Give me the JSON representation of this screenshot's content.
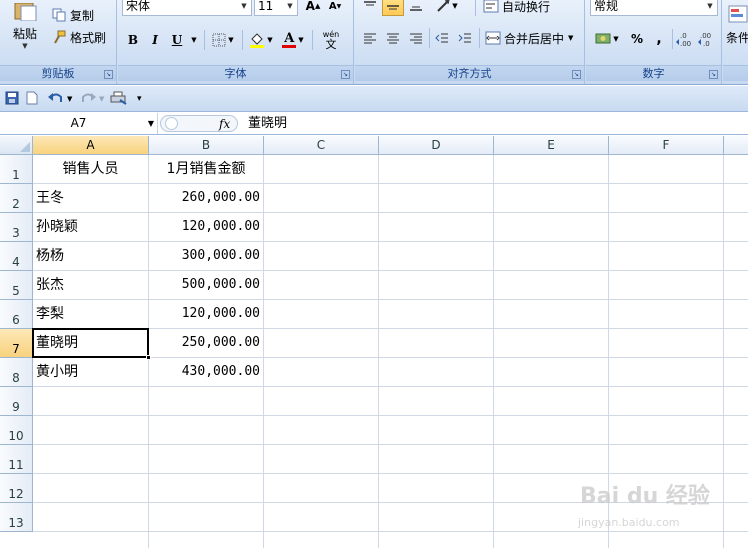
{
  "ribbon": {
    "clipboard": {
      "paste_label": "粘贴",
      "copy_label": "复制",
      "format_painter_label": "格式刷",
      "group_label": "剪贴板"
    },
    "font": {
      "font_name": "宋体",
      "font_size": "11",
      "group_label": "字体",
      "bold": "B",
      "italic": "I",
      "underline": "U",
      "grow": "A",
      "shrink": "A",
      "font_color_letter": "A",
      "phonetic": "wén"
    },
    "alignment": {
      "wrap_text_label": "自动换行",
      "merge_center_label": "合并后居中",
      "group_label": "对齐方式"
    },
    "number": {
      "format": "常规",
      "percent": "%",
      "comma": ",",
      "group_label": "数字"
    },
    "styles": {
      "cond_label": "条件"
    }
  },
  "formula_bar": {
    "name_box": "A7",
    "fx": "fx",
    "content": "董晓明"
  },
  "columns": [
    "A",
    "B",
    "C",
    "D",
    "E",
    "F"
  ],
  "rows": [
    "1",
    "2",
    "3",
    "4",
    "5",
    "6",
    "7",
    "8",
    "9",
    "10",
    "11",
    "12",
    "13"
  ],
  "table": {
    "headers": [
      "销售人员",
      "1月销售金额"
    ],
    "data": [
      [
        "王冬",
        "260,000.00"
      ],
      [
        "孙晓颖",
        "120,000.00"
      ],
      [
        "杨杨",
        "300,000.00"
      ],
      [
        "张杰",
        "500,000.00"
      ],
      [
        "李梨",
        "120,000.00"
      ],
      [
        "董晓明",
        "250,000.00"
      ],
      [
        "黄小明",
        "430,000.00"
      ]
    ]
  },
  "active_cell": "A7",
  "watermark": {
    "main": "Bai du 经验",
    "sub": "jingyan.baidu.com"
  },
  "colors": {
    "ribbon_label": "#15428b",
    "header_active": "#f8d27e",
    "gridline": "#d0d7e5"
  }
}
